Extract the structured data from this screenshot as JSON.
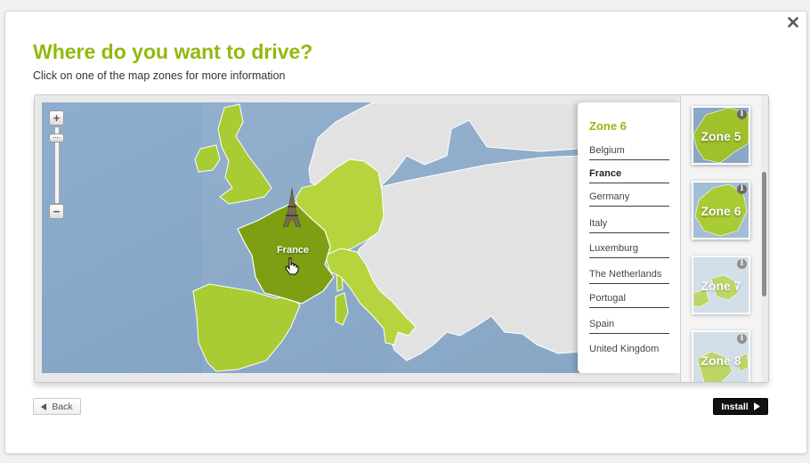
{
  "dialog": {
    "title": "Where do you want to drive?",
    "subtitle": "Click on one of the map zones for more information",
    "close_icon": "close-icon"
  },
  "map": {
    "zoom_in_label": "+",
    "zoom_out_label": "−",
    "zoom_level": 0.1,
    "selected_country_label": "France",
    "landmark_icon": "eiffel-tower-icon",
    "cursor_icon": "hand-pointer-icon",
    "colors": {
      "sea": "#87a8c9",
      "land": "#e2e2e2",
      "zone": "#a9cb33",
      "selected": "#7e9f12"
    }
  },
  "zone_list": {
    "heading": "Zone 6",
    "countries": [
      "Belgium",
      "France",
      "Germany",
      "Italy",
      "Luxemburg",
      "The Netherlands",
      "Portugal",
      "Spain",
      "United Kingdom"
    ],
    "active_country": "France"
  },
  "zone_thumbnails": [
    {
      "label": "Zone 5",
      "info_icon": "info-icon"
    },
    {
      "label": "Zone 6",
      "info_icon": "info-icon"
    },
    {
      "label": "Zone 7",
      "info_icon": "info-icon"
    },
    {
      "label": "Zone 8",
      "info_icon": "info-icon"
    }
  ],
  "footer": {
    "back_label": "Back",
    "install_label": "Install"
  },
  "accent_color": "#92b90d"
}
